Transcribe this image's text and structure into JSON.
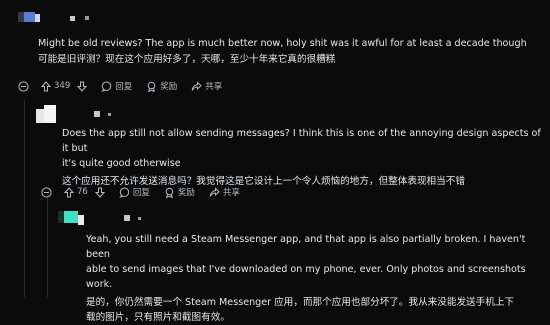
{
  "comments": [
    {
      "text_en": "Might be old reviews? The app is much better now, holy shit was it awful for at least a decade though",
      "text_zh": "可能是旧评测？现在这个应用好多了，天哪，至少十年来它真的很糟糕",
      "votes": "349",
      "reply_label": "回复",
      "award_label": "奖励",
      "share_label": "共享"
    },
    {
      "text_en_1": "Does the app still not allow sending messages? I think this is one of the annoying design aspects of it but",
      "text_en_2": "it's quite good otherwise",
      "text_zh": "这个应用还不允许发送消息吗？我觉得这是它设计上一个令人烦恼的地方，但整体表现相当不错",
      "votes": "76",
      "reply_label": "回复",
      "award_label": "奖励",
      "share_label": "共享"
    },
    {
      "text_en_1": "Yeah, you still need a Steam Messenger app, and that app is also partially broken. I haven't been",
      "text_en_2": "able to send images that I've downloaded on my phone, ever. Only photos and screenshots work.",
      "text_zh_1": "是的，你仍然需要一个 Steam Messenger 应用，而那个应用也部分坏了。我从来没能发送手机上下",
      "text_zh_2": "载的图片，只有照片和截图有效。"
    }
  ],
  "colors": {
    "background": "#0b0b0c",
    "text": "#e6e8ea",
    "meta": "#b6b9bc",
    "avatar_blue": "#5b7bd5",
    "avatar_teal": "#3fe0c0"
  }
}
